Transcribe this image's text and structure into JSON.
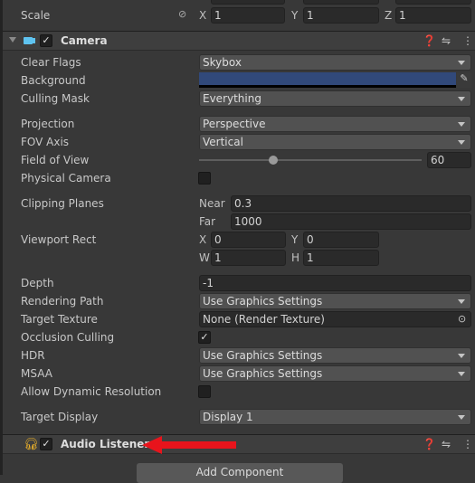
{
  "transform": {
    "scale_label": "Scale",
    "scale": {
      "x": "1",
      "y": "1",
      "z": "1"
    },
    "axis": {
      "x": "X",
      "y": "Y",
      "z": "Z"
    }
  },
  "camera": {
    "title": "Camera",
    "enabled": true,
    "clear_flags": {
      "label": "Clear Flags",
      "value": "Skybox"
    },
    "background": {
      "label": "Background",
      "color": "#31497a"
    },
    "culling_mask": {
      "label": "Culling Mask",
      "value": "Everything"
    },
    "projection": {
      "label": "Projection",
      "value": "Perspective"
    },
    "fov_axis": {
      "label": "FOV Axis",
      "value": "Vertical"
    },
    "fov": {
      "label": "Field of View",
      "value": "60",
      "fraction": 0.335
    },
    "physical_camera": {
      "label": "Physical Camera",
      "checked": false
    },
    "clipping": {
      "label": "Clipping Planes",
      "near_label": "Near",
      "near": "0.3",
      "far_label": "Far",
      "far": "1000"
    },
    "viewport": {
      "label": "Viewport Rect",
      "x_label": "X",
      "x": "0",
      "y_label": "Y",
      "y": "0",
      "w_label": "W",
      "w": "1",
      "h_label": "H",
      "h": "1"
    },
    "depth": {
      "label": "Depth",
      "value": "-1"
    },
    "rendering_path": {
      "label": "Rendering Path",
      "value": "Use Graphics Settings"
    },
    "target_texture": {
      "label": "Target Texture",
      "value": "None (Render Texture)"
    },
    "occlusion_culling": {
      "label": "Occlusion Culling",
      "checked": true
    },
    "hdr": {
      "label": "HDR",
      "value": "Use Graphics Settings"
    },
    "msaa": {
      "label": "MSAA",
      "value": "Use Graphics Settings"
    },
    "dynamic_resolution": {
      "label": "Allow Dynamic Resolution",
      "checked": false
    },
    "target_display": {
      "label": "Target Display",
      "value": "Display 1"
    }
  },
  "audio_listener": {
    "title": "Audio Listener",
    "enabled": true
  },
  "add_component": "Add Component",
  "checkmark": "✓",
  "colors": {
    "annotation_arrow": "#e8141c",
    "camera_icon": "#5fc3f0",
    "audio_icon": "#f0b429"
  }
}
